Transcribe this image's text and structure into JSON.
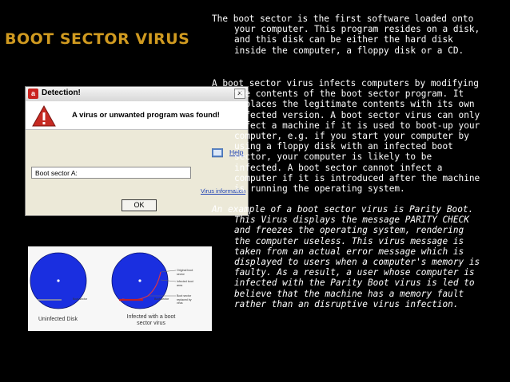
{
  "slide": {
    "title": "Boot Sector Virus",
    "paragraphs": [
      "The boot sector is the first software loaded onto your computer. This program resides on a disk, and this disk can be either the hard disk inside the computer, a floppy disk or a CD.",
      "A boot sector virus infects computers by modifying the contents of the boot sector program. It replaces the legitimate contents with its own infected version. A boot sector virus can only infect a machine if it is used to boot-up your computer, e.g. if you start your computer by using a floppy disk with an infected boot sector, your computer is likely to be infected. A boot sector cannot infect a computer if it is introduced after the machine is running the operating system.",
      "An example of a boot sector virus is Parity Boot. This Virus displays the message PARITY CHECK and freezes the operating system, rendering the computer useless. This virus message is taken from an actual error message which is displayed to users when a computer's memory is faulty. As a result, a user whose computer is infected with the Parity Boot virus is led to believe that the machine has a memory fault rather than an disruptive virus infection."
    ]
  },
  "dialog": {
    "title": "Detection!",
    "message": "A virus or unwanted program was found!",
    "help_label": "Help",
    "field_value": "Boot sector A:",
    "info_link": "Virus information",
    "ok_label": "OK",
    "close_glyph": "✕",
    "logo_glyph": "a"
  },
  "disk_figure": {
    "caption_clean": "Uninfected Disk",
    "caption_infected": "Infected with a boot sector virus",
    "labels": {
      "boot_sector_left": "Boot sector",
      "original_boot": "Original boot sector",
      "infected_area": "Infected boot area",
      "boot_sector_right": "Boot sector",
      "replaced": "Boot sector replaced by virus"
    }
  },
  "colors": {
    "background": "#000000",
    "title": "#d09a20",
    "body_text": "#ffffff",
    "disk": "#1a2fe0"
  }
}
